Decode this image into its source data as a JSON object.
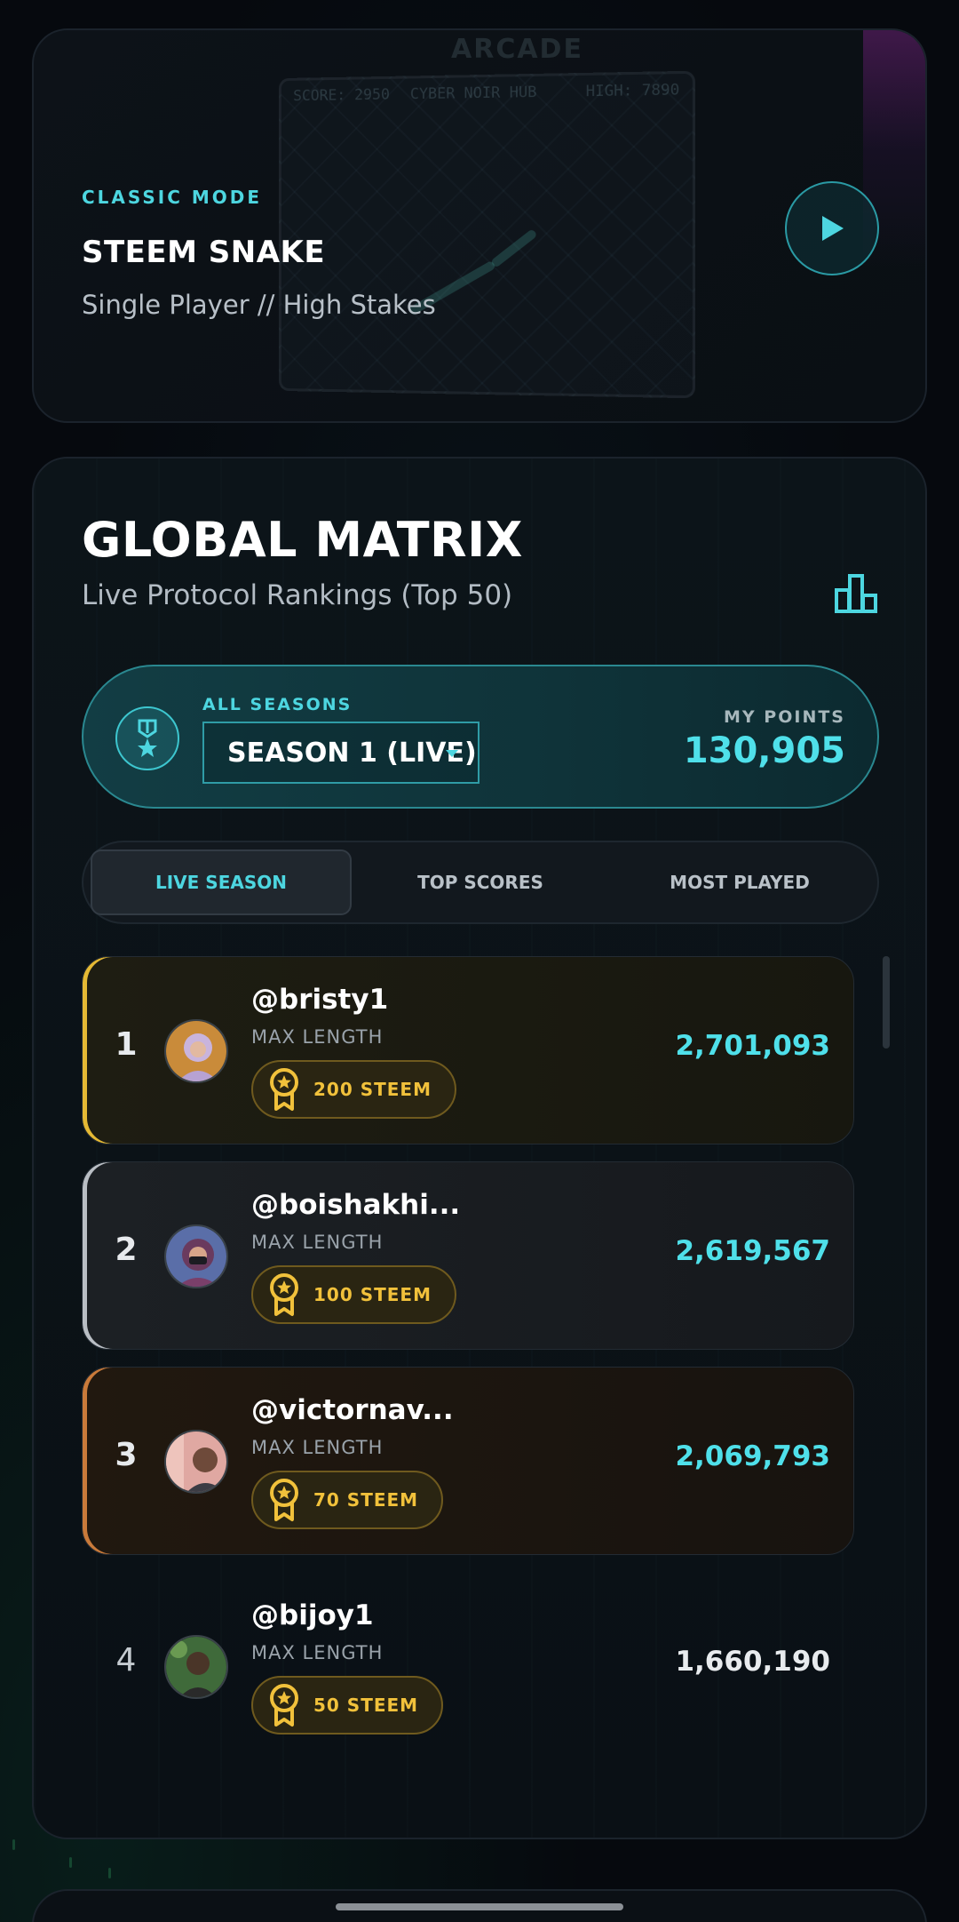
{
  "game": {
    "mode_label": "CLASSIC MODE",
    "title": "STEEM SNAKE",
    "subtitle": "Single Player // High Stakes",
    "play_icon": "play-icon",
    "background": {
      "logo_text": "ARCADE",
      "hud_score": "SCORE: 2950",
      "hud_title": "CYBER NOIR HUB",
      "hud_high": "HIGH: 7890"
    }
  },
  "leaderboard": {
    "title": "GLOBAL MATRIX",
    "subtitle": "Live Protocol Rankings (Top 50)",
    "icon": "podium-icon",
    "season": {
      "label": "ALL SEASONS",
      "selected": "SEASON 1 (LIVE)",
      "badge_icon": "medal-icon",
      "points_label": "MY POINTS",
      "points_value": "130,905"
    },
    "tabs": [
      {
        "label": "LIVE SEASON",
        "active": true
      },
      {
        "label": "TOP SCORES",
        "active": false
      },
      {
        "label": "MOST PLAYED",
        "active": false
      }
    ],
    "rows": [
      {
        "rank": "1",
        "username": "@bristy1",
        "metric": "MAX LENGTH",
        "prize": "200 STEEM",
        "score": "2,701,093",
        "tier": "gold"
      },
      {
        "rank": "2",
        "username": "@boishakhi...",
        "metric": "MAX LENGTH",
        "prize": "100 STEEM",
        "score": "2,619,567",
        "tier": "silver"
      },
      {
        "rank": "3",
        "username": "@victornav...",
        "metric": "MAX LENGTH",
        "prize": "70 STEEM",
        "score": "2,069,793",
        "tier": "bronze"
      },
      {
        "rank": "4",
        "username": "@bijoy1",
        "metric": "MAX LENGTH",
        "prize": "50 STEEM",
        "score": "1,660,190",
        "tier": "plain"
      }
    ]
  },
  "colors": {
    "accent": "#4dd6e0",
    "gold": "#f1c13b",
    "background": "#06090e"
  }
}
